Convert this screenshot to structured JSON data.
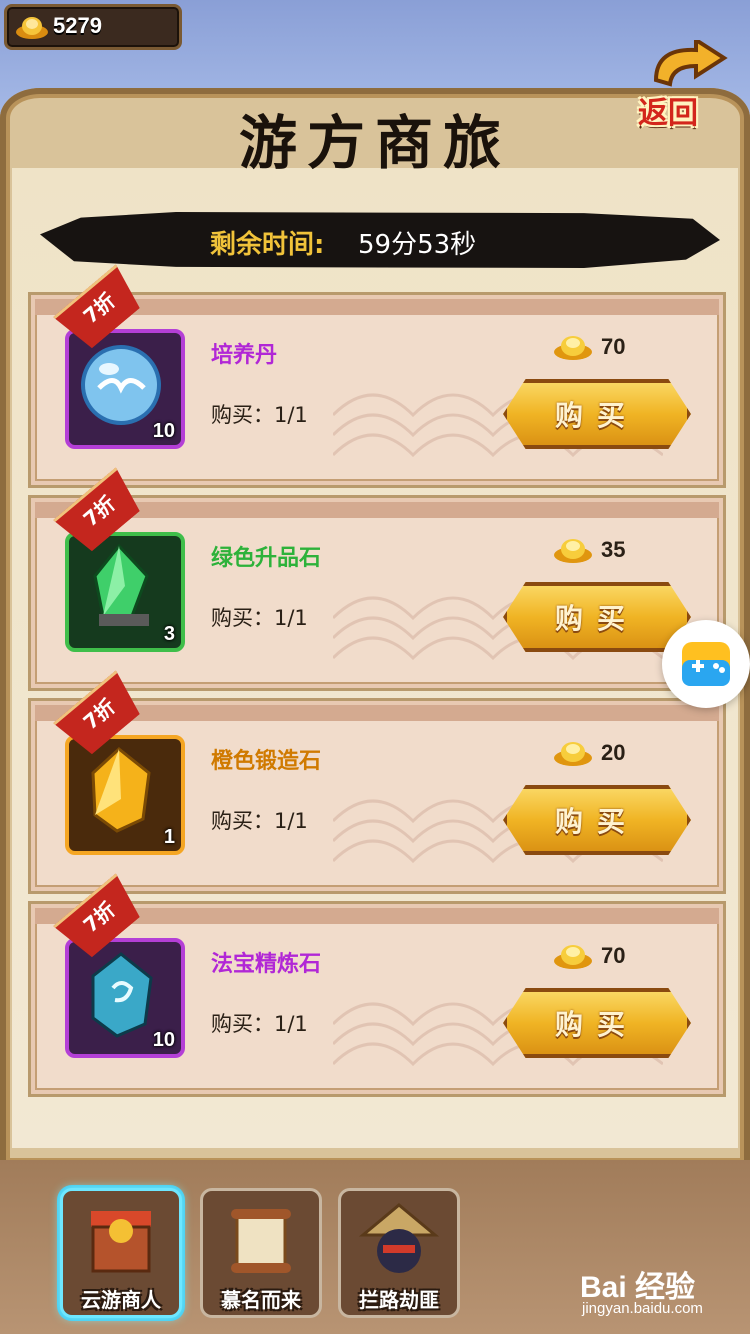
{
  "currency": {
    "amount": "5279"
  },
  "header": {
    "title": "游方商旅",
    "back_label": "返回"
  },
  "timer": {
    "label": "剩余时间:",
    "value": "59分53秒"
  },
  "items": [
    {
      "name": "培养丹",
      "name_color": "#b127d6",
      "frame": "purple",
      "discount": "7折",
      "qty": "10",
      "purchase": "购买：1/1",
      "price": "70",
      "buy_label": "购买",
      "icon": "blue-orb-icon"
    },
    {
      "name": "绿色升品石",
      "name_color": "#2db23a",
      "frame": "green",
      "discount": "7折",
      "qty": "3",
      "purchase": "购买：1/1",
      "price": "35",
      "buy_label": "购买",
      "icon": "green-crystal-icon"
    },
    {
      "name": "橙色锻造石",
      "name_color": "#d07a00",
      "frame": "orange",
      "discount": "7折",
      "qty": "1",
      "purchase": "购买：1/1",
      "price": "20",
      "buy_label": "购买",
      "icon": "orange-gem-icon"
    },
    {
      "name": "法宝精炼石",
      "name_color": "#b127d6",
      "frame": "purple",
      "discount": "7折",
      "qty": "10",
      "purchase": "购买：1/1",
      "price": "70",
      "buy_label": "购买",
      "icon": "blue-rune-stone-icon"
    }
  ],
  "tabs": [
    {
      "label": "云游商人",
      "active": true,
      "icon": "merchant-chest-icon"
    },
    {
      "label": "慕名而来",
      "active": false,
      "icon": "scroll-icon"
    },
    {
      "label": "拦路劫匪",
      "active": false,
      "icon": "bandit-icon"
    }
  ],
  "watermark": {
    "brand": "Bai 经验",
    "url": "jingyan.baidu.com"
  }
}
